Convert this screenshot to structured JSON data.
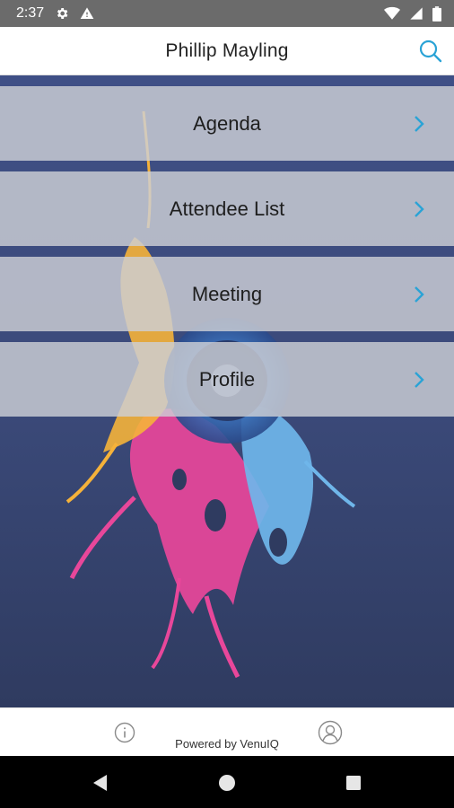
{
  "status_bar": {
    "time": "2:37",
    "icons": [
      "gear-icon",
      "alert-triangle-icon",
      "wifi-icon",
      "cellular-signal-icon",
      "battery-icon"
    ]
  },
  "header": {
    "title": "Phillip Mayling",
    "search_icon": "search-icon",
    "accent_color": "#2aa3d6"
  },
  "menu": {
    "items": [
      {
        "label": "Agenda"
      },
      {
        "label": "Attendee List"
      },
      {
        "label": "Meeting"
      },
      {
        "label": "Profile"
      }
    ],
    "chevron_color": "#2aa3d6"
  },
  "footer": {
    "powered_by": "Powered by VenuIQ",
    "info_icon": "info-icon",
    "profile_icon": "user-profile-icon"
  },
  "nav_bar": {
    "icons": [
      "back-triangle-icon",
      "home-circle-icon",
      "recents-square-icon"
    ]
  }
}
